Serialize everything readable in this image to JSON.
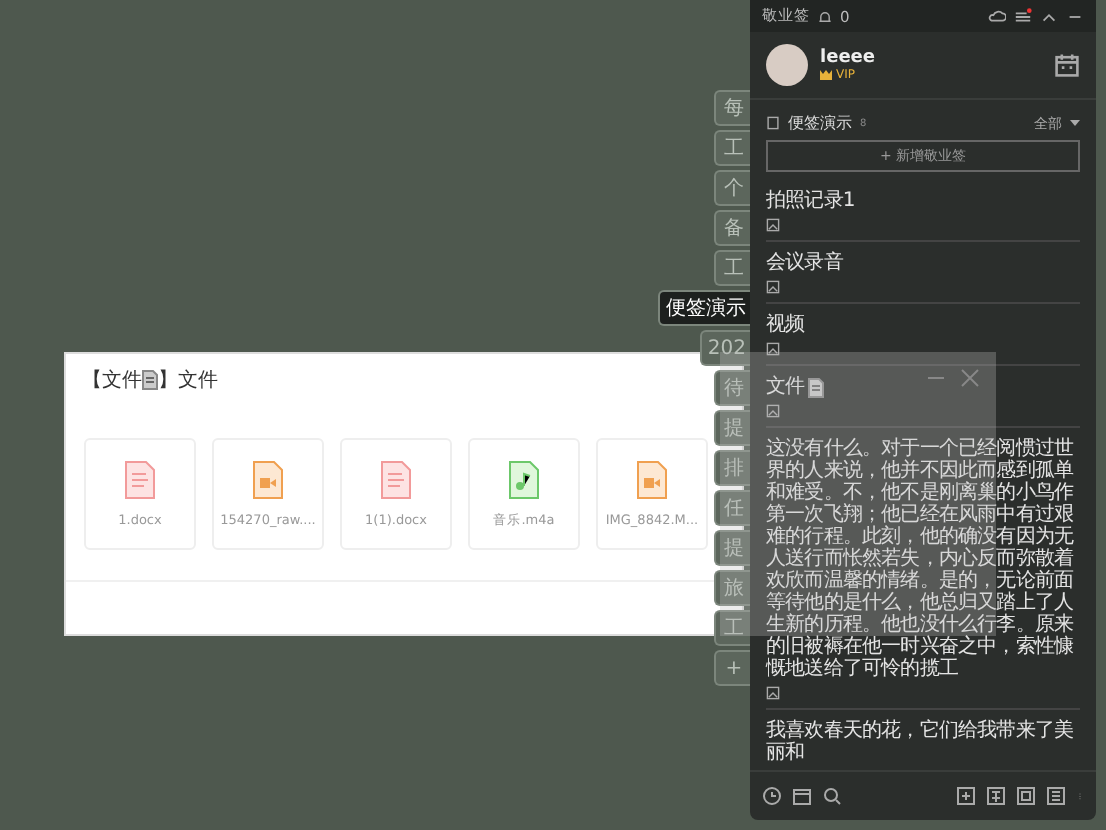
{
  "dialog": {
    "title_before": "【文件",
    "title_after": "】文件",
    "files": [
      {
        "kind": "doc",
        "name": "1.docx"
      },
      {
        "kind": "video",
        "name": "154270_raw...."
      },
      {
        "kind": "doc",
        "name": "1(1).docx"
      },
      {
        "kind": "audio",
        "name": "音乐.m4a"
      },
      {
        "kind": "video",
        "name": "IMG_8842.M..."
      }
    ]
  },
  "side_tabs": [
    {
      "label": "每",
      "selected": false
    },
    {
      "label": "工",
      "selected": false
    },
    {
      "label": "个",
      "selected": false
    },
    {
      "label": "备",
      "selected": false
    },
    {
      "label": "工",
      "selected": false
    },
    {
      "label": "便签演示",
      "selected": true
    },
    {
      "label": "202",
      "selected": false
    },
    {
      "label": "待",
      "selected": false
    },
    {
      "label": "提",
      "selected": false
    },
    {
      "label": "排",
      "selected": false
    },
    {
      "label": "任",
      "selected": false
    },
    {
      "label": "提",
      "selected": false
    },
    {
      "label": "旅",
      "selected": false
    },
    {
      "label": "工",
      "selected": false
    },
    {
      "label": "+",
      "selected": false
    }
  ],
  "panel": {
    "app_name": "敬业签",
    "bell_count": "0",
    "user_name": "leeee",
    "vip": "VIP",
    "group_name": "便签演示",
    "group_count": "8",
    "filter": "全部",
    "new_button": "+ 新增敬业签",
    "notes": [
      {
        "text": "拍照记录1",
        "file_icon": false,
        "image": true
      },
      {
        "text": "会议录音",
        "file_icon": false,
        "image": true
      },
      {
        "text": "视频",
        "file_icon": false,
        "image": true
      },
      {
        "text": "文件",
        "file_icon": true,
        "image": true
      },
      {
        "text": "这没有什么。对于一个已经阅惯过世界的人来说，他并不因此而感到孤单和难受。不，他不是刚离巢的小鸟作第一次飞翔；他已经在风雨中有过艰难的行程。此刻，他的确没有因为无人送行而怅然若失，内心反而弥散着欢欣而温馨的情绪。是的，无论前面等待他的是什么，他总归又踏上了人生新的历程。他也没什么行李。原来的旧被褥在他一时兴奋之中，索性慷慨地送给了可怜的揽工",
        "file_icon": false,
        "image": true
      },
      {
        "text": "我喜欢春天的花，它们给我带来了美丽和",
        "file_icon": false,
        "image": false
      }
    ]
  }
}
